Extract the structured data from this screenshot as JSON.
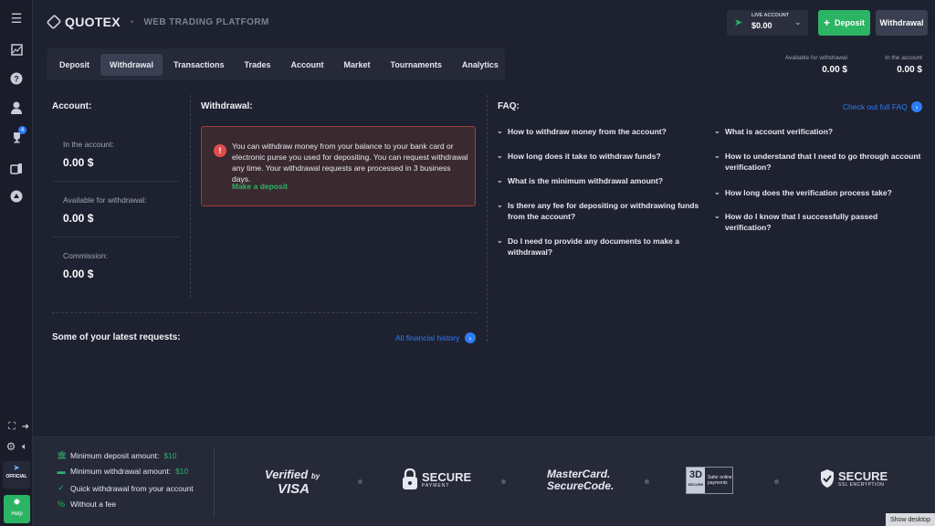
{
  "header": {
    "brand": "QUOTEX",
    "separator": "•",
    "platform": "WEB TRADING PLATFORM",
    "live_account_label": "LIVE ACCOUNT",
    "live_account_value": "$0.00",
    "deposit_label": "Deposit",
    "withdrawal_label": "Withdrawal"
  },
  "tabs": [
    "Deposit",
    "Withdrawal",
    "Transactions",
    "Trades",
    "Account",
    "Market",
    "Tournaments",
    "Analytics"
  ],
  "active_tab": "Withdrawal",
  "sidebar": {
    "badge": "4",
    "official_label": "OFFICIAL",
    "help_label": "Help"
  },
  "top_stats": {
    "available_label": "Available for withdrawal",
    "available_value": "0.00 $",
    "account_label": "In the account",
    "account_value": "0.00 $"
  },
  "account": {
    "title": "Account:",
    "items": [
      {
        "label": "In the account:",
        "value": "0.00 $"
      },
      {
        "label": "Available for withdrawal:",
        "value": "0.00 $"
      },
      {
        "label": "Commission:",
        "value": "0.00 $"
      }
    ]
  },
  "withdrawal": {
    "title": "Withdrawal:",
    "alert_text": "You can withdraw money from your balance to your bank card or electronic purse you used for depositing. You can request withdrawal any time. Your withdrawal requests are processed in 3 business days.",
    "alert_link": "Make a deposit"
  },
  "latest": {
    "title": "Some of your latest requests:",
    "link": "All financial history"
  },
  "faq": {
    "title": "FAQ:",
    "link": "Check out full FAQ",
    "left": [
      "How to withdraw money from the account?",
      "How long does it take to withdraw funds?",
      "What is the minimum withdrawal amount?",
      "Is there any fee for depositing or withdrawing funds from the account?",
      "Do I need to provide any documents to make a withdrawal?"
    ],
    "right": [
      "What is account verification?",
      "How to understand that I need to go through account verification?",
      "How long does the verification process take?",
      "How do I know that I successfully passed verification?"
    ]
  },
  "bottom": {
    "min_deposit_label": "Minimum deposit amount:",
    "min_deposit_value": "$10",
    "min_withdrawal_label": "Minimum withdrawal amount:",
    "min_withdrawal_value": "$10",
    "quick": "Quick withdrawal from your account",
    "fee": "Without a fee",
    "badges": {
      "visa_top": "Verified",
      "visa_by": "by",
      "visa_bottom": "VISA",
      "secure1_top": "SECURE",
      "secure1_bottom": "PAYMENT",
      "mc_top": "MasterCard.",
      "mc_bottom": "SecureCode.",
      "threed": "3D",
      "threed_sub": "SECURE",
      "threed_text": "Safer online payments",
      "secure2_top": "SECURE",
      "secure2_bottom": "SSL ENCRYPTION"
    }
  },
  "taskbar": {
    "show_desktop": "Show desktop"
  },
  "colors": {
    "accent_green": "#2ab463",
    "accent_blue": "#2d7cf6",
    "alert_red": "#e24c4f",
    "background": "#1e2130"
  }
}
